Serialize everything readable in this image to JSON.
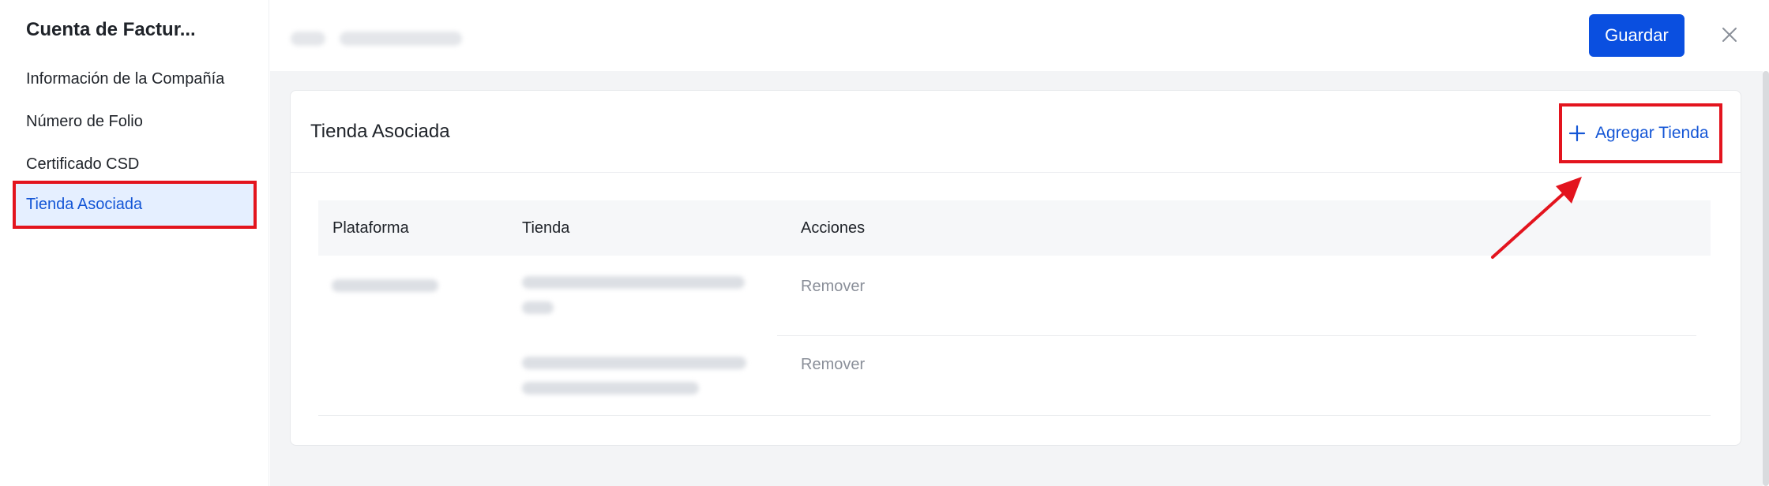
{
  "sidebar": {
    "title": "Cuenta de Factur...",
    "items": [
      {
        "label": "Información de la Compañía"
      },
      {
        "label": "Número de Folio"
      },
      {
        "label": "Certificado CSD"
      },
      {
        "label": "Tienda Asociada",
        "active": true
      }
    ]
  },
  "header": {
    "save_label": "Guardar",
    "close_icon": "close-icon"
  },
  "card": {
    "title": "Tienda Asociada",
    "add_store_label": "Agregar Tienda",
    "add_icon": "plus-icon"
  },
  "table": {
    "columns": [
      "Plataforma",
      "Tienda",
      "Acciones"
    ],
    "rows": [
      {
        "action": "Remover"
      },
      {
        "action": "Remover"
      }
    ]
  },
  "colors": {
    "primary": "#0a4fe0",
    "link": "#1456d6",
    "highlight": "#e3141e",
    "active_bg": "#e5efff"
  }
}
